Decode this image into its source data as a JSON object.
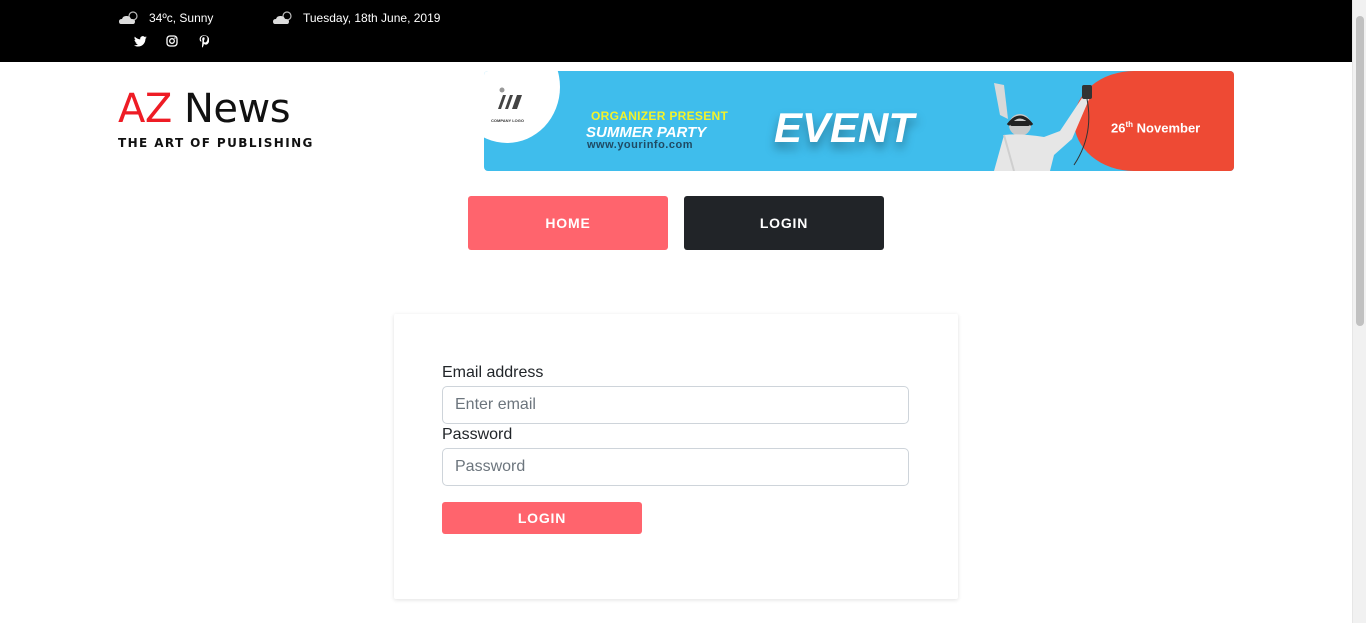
{
  "topbar": {
    "weather_text": "34ºc, Sunny",
    "date_text": "Tuesday, 18th June, 2019",
    "weather_icon": "cloud-sun-icon",
    "socials": [
      "twitter-icon",
      "instagram-icon",
      "pinterest-icon"
    ]
  },
  "logo": {
    "az": "AZ",
    "news": "News",
    "tagline": "THE ART OF PUBLISHING"
  },
  "banner": {
    "company_logo": "COMPANY LOGO",
    "organizer": "ORGANIZER PRESENT",
    "party": "SUMMER PARTY",
    "url": "www.yourinfo.com",
    "event": "EVENT",
    "date_day": "26",
    "date_suffix": "th",
    "date_month": "November"
  },
  "nav": {
    "home": "HOME",
    "login": "LOGIN"
  },
  "form": {
    "email_label": "Email address",
    "email_placeholder": "Enter email",
    "password_label": "Password",
    "password_placeholder": "Password",
    "submit": "LOGIN"
  },
  "colors": {
    "accent": "#ff646d",
    "dark_button": "#212428",
    "topbar": "#000000",
    "logo_red": "#ee1c25"
  }
}
